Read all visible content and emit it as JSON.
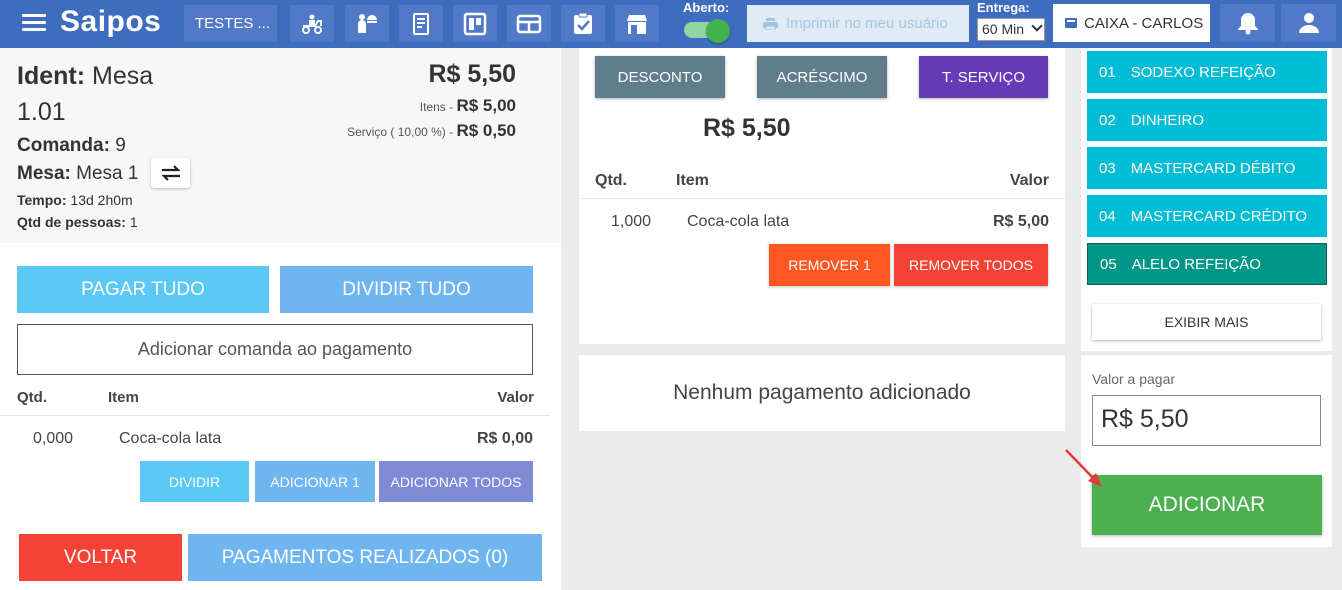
{
  "header": {
    "logo": "Saipos",
    "store": "TESTES ...",
    "aberto_label": "Aberto:",
    "print_label": "Imprimir no meu usuário",
    "entrega_label": "Entrega:",
    "entrega_value": "60 Min",
    "caixa_label": "CAIXA - CARLOS",
    "nav_icons": [
      "delivery-icon",
      "waiter-icon",
      "order-pad-icon",
      "board-icon",
      "counter-icon",
      "checklist-icon",
      "store-icon"
    ]
  },
  "info": {
    "ident_label": "Ident:",
    "ident_value": "Mesa",
    "ident_value2": "1.01",
    "comanda_label": "Comanda:",
    "comanda_value": "9",
    "mesa_label": "Mesa:",
    "mesa_value": "Mesa 1",
    "tempo_label": "Tempo:",
    "tempo_value": "13d 2h0m",
    "qtdp_label": "Qtd de pessoas:",
    "qtdp_value": "1",
    "total": "R$ 5,50",
    "itens_label": "Itens - ",
    "itens_value": "R$ 5,00",
    "servico_label": "Serviço ( 10,00 %) - ",
    "servico_value": "R$ 0,50"
  },
  "left": {
    "pagar_tudo": "PAGAR TUDO",
    "dividir_tudo": "DIVIDIR TUDO",
    "add_comanda": "Adicionar comanda ao pagamento",
    "columns": {
      "qtd": "Qtd.",
      "item": "Item",
      "valor": "Valor"
    },
    "row": {
      "qtd": "0,000",
      "item": "Coca-cola lata",
      "valor": "R$ 0,00"
    },
    "dividir": "DIVIDIR",
    "adicionar1": "ADICIONAR 1",
    "adicionar_todos": "ADICIONAR TODOS",
    "voltar": "VOLTAR",
    "pagamentos_realizados": "PAGAMENTOS REALIZADOS (0)"
  },
  "middle": {
    "desconto": "DESCONTO",
    "acrescimo": "ACRÉSCIMO",
    "servico": "T. SERVIÇO",
    "total": "R$ 5,50",
    "columns": {
      "qtd": "Qtd.",
      "item": "Item",
      "valor": "Valor"
    },
    "row": {
      "qtd": "1,000",
      "item": "Coca-cola lata",
      "valor": "R$ 5,00"
    },
    "remover1": "REMOVER 1",
    "remover_todos": "REMOVER TODOS",
    "empty_payments": "Nenhum pagamento adicionado"
  },
  "payment_methods": [
    {
      "code": "01",
      "name": "SODEXO REFEIÇÃO"
    },
    {
      "code": "02",
      "name": "DINHEIRO"
    },
    {
      "code": "03",
      "name": "MASTERCARD DÉBITO"
    },
    {
      "code": "04",
      "name": "MASTERCARD CRÉDITO"
    },
    {
      "code": "05",
      "name": "ALELO REFEIÇÃO"
    }
  ],
  "right": {
    "exibir_mais": "EXIBIR MAIS",
    "valor_label": "Valor a pagar",
    "valor_value": "R$ 5,50",
    "adicionar": "ADICIONAR"
  },
  "colors": {
    "header": "#3e6cbf",
    "pagar": "#5bc8f5",
    "dividir": "#6fb6f1",
    "voltar": "#f44336",
    "desconto": "#607d8b",
    "servico": "#673ab7",
    "remover1": "#ff5722",
    "remover_todos": "#f44336",
    "payment": "#00bcd4",
    "payment_selected": "#009688",
    "adicionar": "#4caf50"
  }
}
